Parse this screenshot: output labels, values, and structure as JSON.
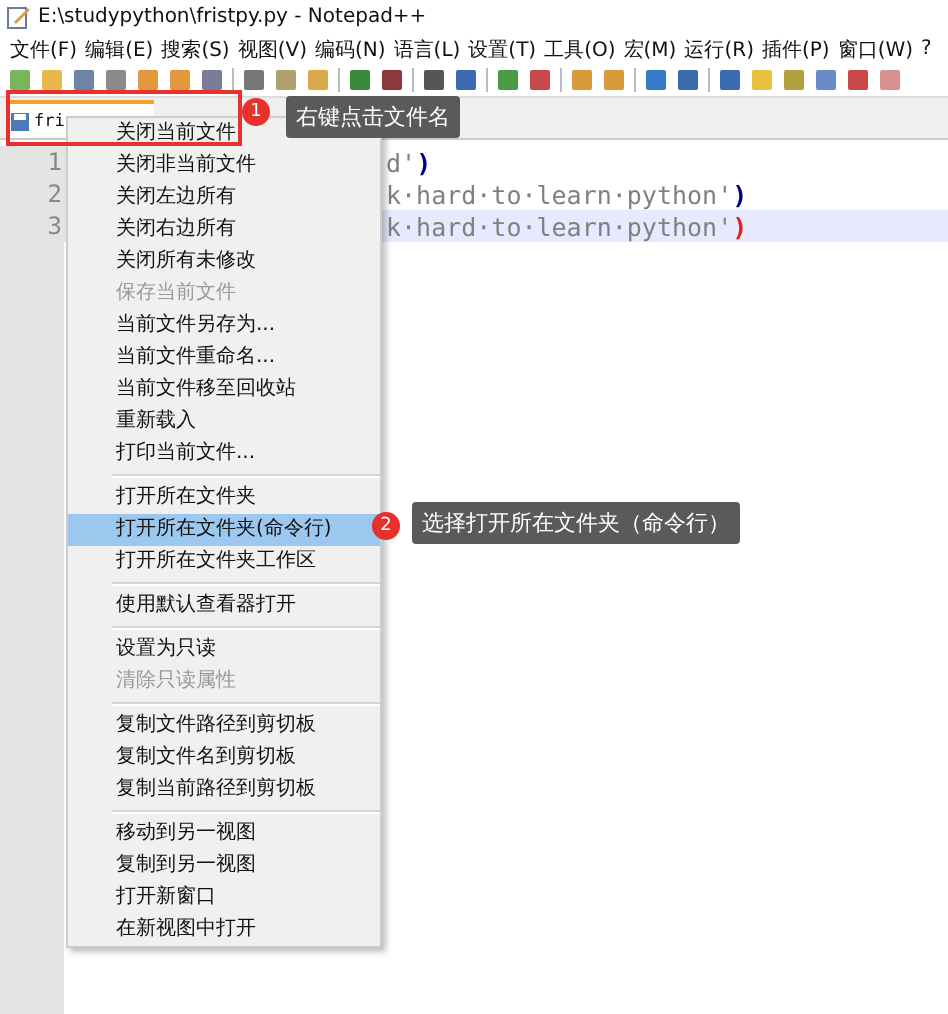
{
  "window": {
    "title": "E:\\studypython\\fristpy.py - Notepad++"
  },
  "menu_bar": [
    "文件(F)",
    "编辑(E)",
    "搜索(S)",
    "视图(V)",
    "编码(N)",
    "语言(L)",
    "设置(T)",
    "工具(O)",
    "宏(M)",
    "运行(R)",
    "插件(P)",
    "窗口(W)",
    "?"
  ],
  "tabs": [
    {
      "label": "fri",
      "selected": true
    }
  ],
  "editor": {
    "lines": [
      {
        "number": "1",
        "text": "d'",
        "bracket": ")",
        "bracket_match": false,
        "current": false
      },
      {
        "number": "2",
        "text": "k·hard·to·learn·python'",
        "bracket": ")",
        "bracket_match": false,
        "current": false
      },
      {
        "number": "3",
        "text": "k·hard·to·learn·python'",
        "bracket": ")",
        "bracket_match": true,
        "current": true
      }
    ]
  },
  "context_menu": {
    "groups": [
      {
        "items": [
          {
            "label": "关闭当前文件",
            "disabled": false,
            "selected": false
          },
          {
            "label": "关闭非当前文件",
            "disabled": false,
            "selected": false
          },
          {
            "label": "关闭左边所有",
            "disabled": false,
            "selected": false
          },
          {
            "label": "关闭右边所有",
            "disabled": false,
            "selected": false
          },
          {
            "label": "关闭所有未修改",
            "disabled": false,
            "selected": false
          },
          {
            "label": "保存当前文件",
            "disabled": true,
            "selected": false
          },
          {
            "label": "当前文件另存为...",
            "disabled": false,
            "selected": false
          },
          {
            "label": "当前文件重命名...",
            "disabled": false,
            "selected": false
          },
          {
            "label": "当前文件移至回收站",
            "disabled": false,
            "selected": false
          },
          {
            "label": "重新载入",
            "disabled": false,
            "selected": false
          },
          {
            "label": "打印当前文件...",
            "disabled": false,
            "selected": false
          }
        ]
      },
      {
        "items": [
          {
            "label": "打开所在文件夹",
            "disabled": false,
            "selected": false
          },
          {
            "label": "打开所在文件夹(命令行)",
            "disabled": false,
            "selected": true
          },
          {
            "label": "打开所在文件夹工作区",
            "disabled": false,
            "selected": false
          }
        ]
      },
      {
        "items": [
          {
            "label": "使用默认查看器打开",
            "disabled": false,
            "selected": false
          }
        ]
      },
      {
        "items": [
          {
            "label": "设置为只读",
            "disabled": false,
            "selected": false
          },
          {
            "label": "清除只读属性",
            "disabled": true,
            "selected": false
          }
        ]
      },
      {
        "items": [
          {
            "label": "复制文件路径到剪切板",
            "disabled": false,
            "selected": false
          },
          {
            "label": "复制文件名到剪切板",
            "disabled": false,
            "selected": false
          },
          {
            "label": "复制当前路径到剪切板",
            "disabled": false,
            "selected": false
          }
        ]
      },
      {
        "items": [
          {
            "label": "移动到另一视图",
            "disabled": false,
            "selected": false
          },
          {
            "label": "复制到另一视图",
            "disabled": false,
            "selected": false
          },
          {
            "label": "打开新窗口",
            "disabled": false,
            "selected": false
          },
          {
            "label": "在新视图中打开",
            "disabled": false,
            "selected": false
          }
        ]
      }
    ]
  },
  "annotations": [
    {
      "number": "1",
      "text": "右键点击文件名"
    },
    {
      "number": "2",
      "text": "选择打开所在文件夹（命令行）"
    }
  ]
}
